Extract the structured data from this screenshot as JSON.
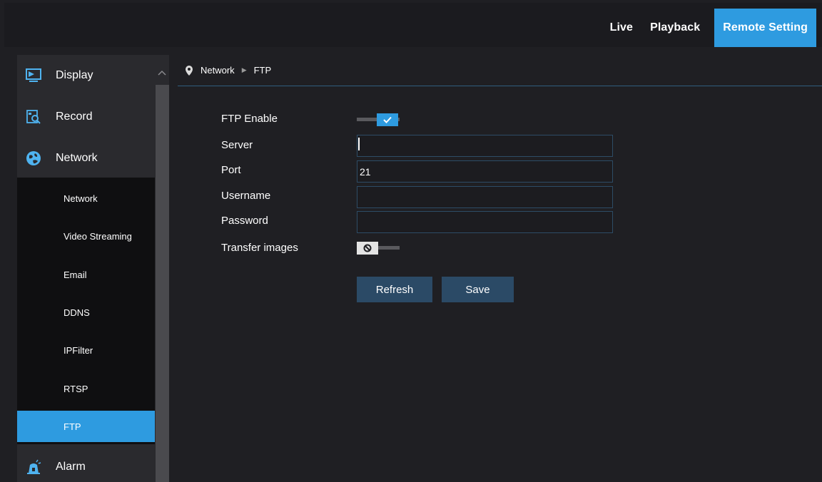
{
  "top_nav": {
    "items": [
      {
        "label": "Live",
        "active": false
      },
      {
        "label": "Playback",
        "active": false
      },
      {
        "label": "Remote Setting",
        "active": true
      }
    ],
    "accent_color": "#2e9be0"
  },
  "sidebar": {
    "groups": [
      {
        "label": "Display",
        "icon": "display-icon"
      },
      {
        "label": "Record",
        "icon": "record-search-icon"
      },
      {
        "label": "Network",
        "icon": "network-globe-icon",
        "expanded": true
      },
      {
        "label": "Alarm",
        "icon": "alarm-bell-icon"
      }
    ],
    "network_items": [
      {
        "label": "Network",
        "active": false
      },
      {
        "label": "Video Streaming",
        "active": false
      },
      {
        "label": "Email",
        "active": false
      },
      {
        "label": "DDNS",
        "active": false
      },
      {
        "label": "IPFilter",
        "active": false
      },
      {
        "label": "RTSP",
        "active": false
      },
      {
        "label": "FTP",
        "active": true
      }
    ]
  },
  "breadcrumb": {
    "icon": "location-pin-icon",
    "parent": "Network",
    "separator_icon": "triangle-right-icon",
    "current": "FTP"
  },
  "form": {
    "ftp_enable": {
      "label": "FTP Enable",
      "checked": true,
      "icon": "check-icon"
    },
    "server": {
      "label": "Server",
      "value": ""
    },
    "port": {
      "label": "Port",
      "value": "21"
    },
    "username": {
      "label": "Username",
      "value": ""
    },
    "password": {
      "label": "Password",
      "value": ""
    },
    "transfer_images": {
      "label": "Transfer images",
      "checked": false,
      "icon": "disabled-circle-icon"
    }
  },
  "buttons": {
    "refresh": "Refresh",
    "save": "Save"
  }
}
